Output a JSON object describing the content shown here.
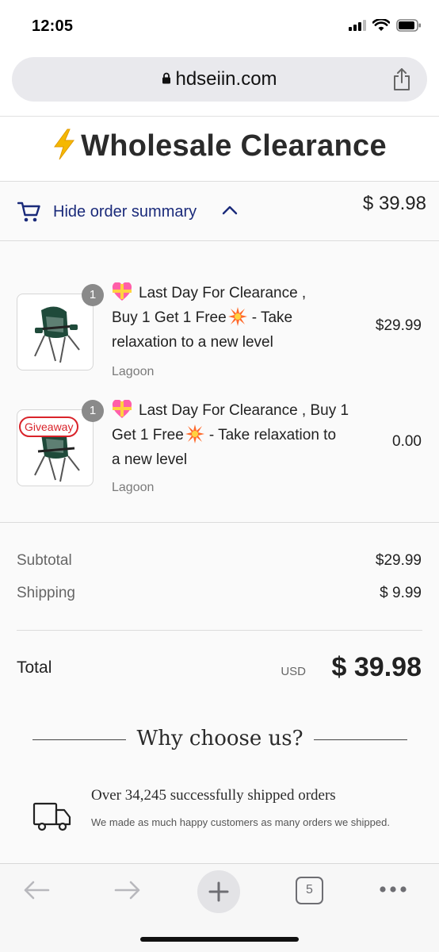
{
  "status_bar": {
    "time": "12:05",
    "icons": [
      "signal-icon",
      "wifi-icon",
      "battery-icon"
    ]
  },
  "browser": {
    "url": "hdseiin.com",
    "tabs_count": "5"
  },
  "store": {
    "title": "Wholesale Clearance"
  },
  "summary_toggle": {
    "label": "Hide order summary",
    "total": "$ 39.98"
  },
  "products": [
    {
      "quantity": "1",
      "title_line1": "Last Day For Clearance ,",
      "title_line2": "Buy 1 Get 1 Free",
      "title_line2_tail": "- Take",
      "title_line3": "relaxation to a new level",
      "variant": "Lagoon",
      "price": "$29.99"
    },
    {
      "quantity": "1",
      "badge": "Giveaway",
      "title_line1": "Last Day For Clearance , Buy 1",
      "title_line2": "Get 1 Free",
      "title_line2_tail": "- Take relaxation to",
      "title_line3": "a new level",
      "variant": "Lagoon",
      "price": "0.00"
    }
  ],
  "totals": {
    "subtotal_label": "Subtotal",
    "subtotal_value": "$29.99",
    "shipping_label": "Shipping",
    "shipping_value": "$ 9.99",
    "total_label": "Total",
    "currency": "USD",
    "total_value": "$ 39.98"
  },
  "why_us": {
    "title": "Why choose us?",
    "feature_title": "Over 34,245 successfully shipped orders",
    "feature_desc": "We made as much happy customers as many orders we shipped."
  },
  "colors": {
    "link": "#1a2a7a",
    "giveaway": "#d9232a",
    "bolt": "#f5b800"
  }
}
